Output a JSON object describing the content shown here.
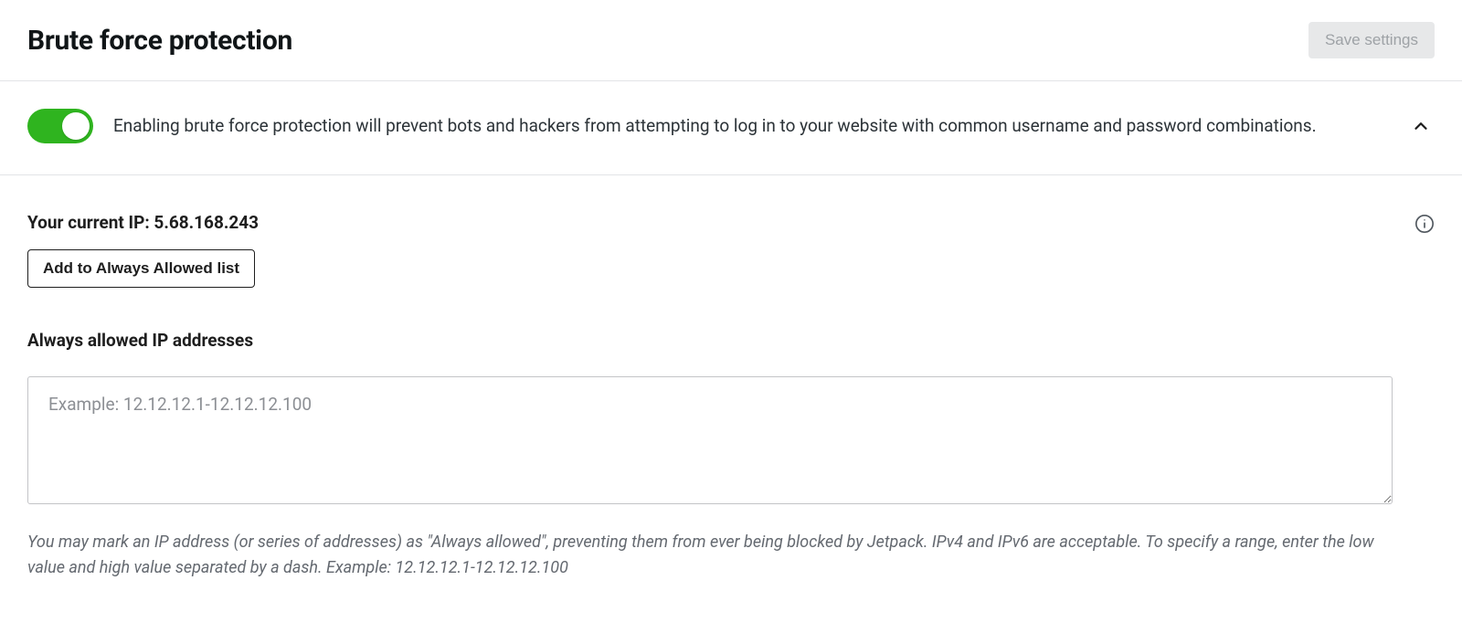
{
  "header": {
    "title": "Brute force protection",
    "save_label": "Save settings"
  },
  "toggle": {
    "enabled": true,
    "description": "Enabling brute force protection will prevent bots and hackers from attempting to log in to your website with common username and password combinations."
  },
  "current_ip": {
    "label_prefix": "Your current IP: ",
    "value": "5.68.168.243",
    "full_label": "Your current IP: 5.68.168.243",
    "add_button_label": "Add to Always Allowed list"
  },
  "allowed_list": {
    "label": "Always allowed IP addresses",
    "placeholder": "Example: 12.12.12.1-12.12.12.100",
    "value": "",
    "help_text": "You may mark an IP address (or series of addresses) as \"Always allowed\", preventing them from ever being blocked by Jetpack. IPv4 and IPv6 are acceptable. To specify a range, enter the low value and high value separated by a dash. Example: 12.12.12.1-12.12.12.100"
  }
}
